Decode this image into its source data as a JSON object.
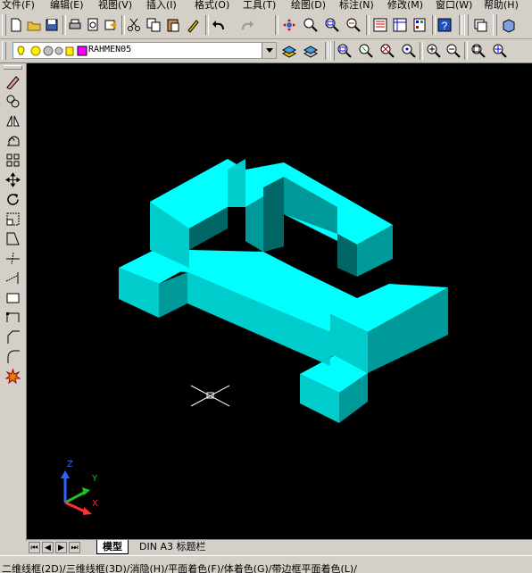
{
  "menu": {
    "items": [
      "文件(F)",
      "编辑(E)",
      "视图(V)",
      "插入(I)",
      "格式(O)",
      "工具(T)",
      "绘图(D)",
      "标注(N)",
      "修改(M)",
      "窗口(W)",
      "帮助(H)"
    ]
  },
  "layer": {
    "name": "RAHMEN05",
    "color": "#ff00ff"
  },
  "tabs": {
    "model": "模型",
    "layout": "DIN A3 标题栏"
  },
  "status": {
    "text": "二维线框(2D)/三维线框(3D)/消隐(H)/平面着色(F)/体着色(G)/带边框平面着色(L)/"
  },
  "ucs": {
    "x": "X",
    "y": "Y",
    "z": "Z"
  },
  "colors": {
    "model_top": "#00ffff",
    "model_left": "#00cccc",
    "model_right": "#009999",
    "viewport_bg": "#000000"
  },
  "icons": {
    "toolbar_standard": [
      "new-icon",
      "open-icon",
      "save-icon",
      "print-icon",
      "preview-icon",
      "publish-icon",
      "cut-icon",
      "copy-icon",
      "paste-icon",
      "matchprop-icon",
      "undo-icon",
      "redo-icon",
      "pan-icon",
      "zoom-realtime-icon",
      "zoom-window-icon",
      "zoom-previous-icon",
      "properties-icon",
      "designcenter-icon",
      "toolpalette-icon",
      "help-icon",
      "ucs-icon",
      "view-icon"
    ],
    "toolbar_zoom": [
      "zoom-window-icon",
      "zoom-dynamic-icon",
      "zoom-scale-icon",
      "zoom-center-icon",
      "zoom-in-icon",
      "zoom-out-icon",
      "zoom-all-icon",
      "zoom-extents-icon"
    ],
    "modify_toolbar": [
      "erase-icon",
      "copy-object-icon",
      "mirror-icon",
      "offset-icon",
      "array-icon",
      "move-icon",
      "rotate-icon",
      "scale-icon",
      "stretch-icon",
      "trim-icon",
      "extend-icon",
      "break-icon",
      "join-icon",
      "chamfer-icon",
      "fillet-icon",
      "explode-icon"
    ]
  }
}
